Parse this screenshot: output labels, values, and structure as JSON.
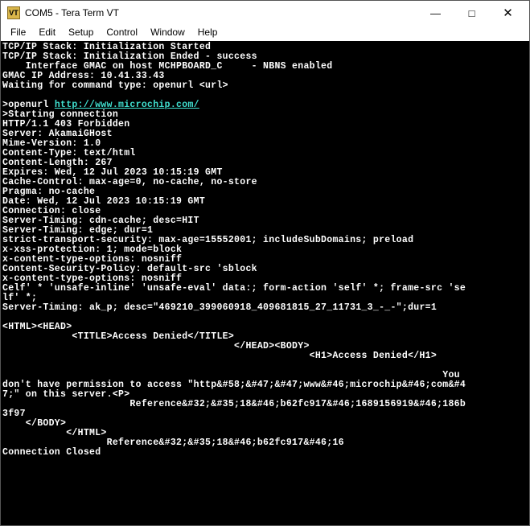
{
  "window": {
    "icon_text": "VT",
    "title": "COM5 - Tera Term VT"
  },
  "menu": {
    "file": "File",
    "edit": "Edit",
    "setup": "Setup",
    "control": "Control",
    "window": "Window",
    "help": "Help"
  },
  "term": {
    "l1": "TCP/IP Stack: Initialization Started",
    "l2": "TCP/IP Stack: Initialization Ended - success",
    "l3": "    Interface GMAC on host MCHPBOARD_C     - NBNS enabled",
    "l4": "GMAC IP Address: 10.41.33.43",
    "l5": "Waiting for command type: openurl <url>",
    "l6": "",
    "l7a": ">openurl ",
    "l7b": "http://www.microchip.com/",
    "l8": ">Starting connection",
    "l9": "HTTP/1.1 403 Forbidden",
    "l10": "Server: AkamaiGHost",
    "l11": "Mime-Version: 1.0",
    "l12": "Content-Type: text/html",
    "l13": "Content-Length: 267",
    "l14": "Expires: Wed, 12 Jul 2023 10:15:19 GMT",
    "l15": "Cache-Control: max-age=0, no-cache, no-store",
    "l16": "Pragma: no-cache",
    "l17": "Date: Wed, 12 Jul 2023 10:15:19 GMT",
    "l18": "Connection: close",
    "l19": "Server-Timing: cdn-cache; desc=HIT",
    "l20": "Server-Timing: edge; dur=1",
    "l21": "strict-transport-security: max-age=15552001; includeSubDomains; preload",
    "l22": "x-xss-protection: 1; mode=block",
    "l23": "x-content-type-options: nosniff",
    "l24": "Content-Security-Policy: default-src 'sblock",
    "l25": "x-content-type-options: nosniff",
    "l26": "Celf' * 'unsafe-inline' 'unsafe-eval' data:; form-action 'self' *; frame-src 'se",
    "l27": "lf' *;",
    "l28": "Server-Timing: ak_p; desc=\"469210_399060918_409681815_27_11731_3_-_-\";dur=1",
    "l29": "",
    "l30": "<HTML><HEAD>",
    "l31": "            <TITLE>Access Denied</TITLE>",
    "l32": "                                        </HEAD><BODY>",
    "l33": "                                                     <H1>Access Denied</H1>",
    "l34": " ",
    "l35": "                                                                            You ",
    "l36": "don't have permission to access \"http&#58;&#47;&#47;www&#46;microchip&#46;com&#4",
    "l37": "7;\" on this server.<P>",
    "l38": "                      Reference&#32;&#35;18&#46;b62fc917&#46;1689156919&#46;186b",
    "l39": "3f97",
    "l40": "    </BODY>",
    "l41": "           </HTML>",
    "l42": "                  Reference&#32;&#35;18&#46;b62fc917&#46;16",
    "l43": "Connection Closed"
  }
}
